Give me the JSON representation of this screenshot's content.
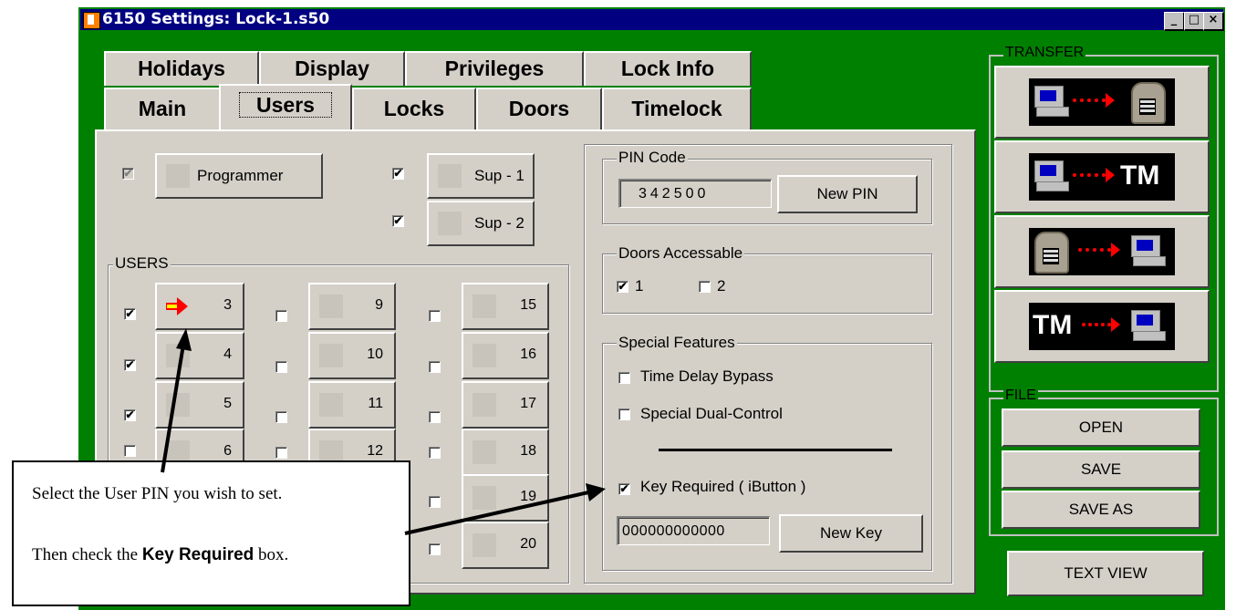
{
  "window": {
    "title": "6150 Settings: Lock-1.s50",
    "buttons": {
      "minimize": "_",
      "restore": "□",
      "close": "×"
    }
  },
  "tabs_row1": [
    "Holidays",
    "Display",
    "Privileges",
    "Lock Info"
  ],
  "tabs_row2": [
    "Main",
    "Users",
    "Locks",
    "Doors",
    "Timelock"
  ],
  "active_tab": "Users",
  "top_buttons": {
    "programmer": {
      "label": "Programmer",
      "checked": true,
      "disabled": true
    },
    "sup1": {
      "label": "Sup - 1",
      "checked": true
    },
    "sup2": {
      "label": "Sup - 2",
      "checked": true
    }
  },
  "users": {
    "group_label": "USERS",
    "col1": [
      {
        "num": "3",
        "checked": true,
        "selected": true
      },
      {
        "num": "4",
        "checked": true
      },
      {
        "num": "5",
        "checked": true
      },
      {
        "num": "6",
        "checked": false
      }
    ],
    "col2": [
      {
        "num": "9",
        "checked": false
      },
      {
        "num": "10",
        "checked": false
      },
      {
        "num": "11",
        "checked": false
      },
      {
        "num": "12",
        "checked": false
      }
    ],
    "col3": [
      {
        "num": "15",
        "checked": false
      },
      {
        "num": "16",
        "checked": false
      },
      {
        "num": "17",
        "checked": false
      },
      {
        "num": "18",
        "checked": false
      },
      {
        "num": "19",
        "checked": false
      },
      {
        "num": "20",
        "checked": false
      }
    ]
  },
  "pin_code": {
    "group_label": "PIN Code",
    "value": "342500",
    "new_pin_label": "New PIN"
  },
  "doors": {
    "group_label": "Doors Accessable",
    "door1": "1",
    "door2": "2",
    "door1_checked": true,
    "door2_checked": false
  },
  "special": {
    "group_label": "Special Features",
    "time_delay": "Time Delay Bypass",
    "dual_control": "Special Dual-Control",
    "key_required": "Key Required ( iButton )",
    "key_value": "000000000000",
    "new_key_label": "New Key"
  },
  "transfer": {
    "group_label": "TRANSFER",
    "tm": "TM"
  },
  "file": {
    "group_label": "FILE",
    "open": "OPEN",
    "save": "SAVE",
    "save_as": "SAVE AS"
  },
  "text_view": "TEXT VIEW",
  "callout": {
    "line1": "Select the User PIN you wish to set.",
    "line2_pre": "Then check the ",
    "line2_bold": "Key Required",
    "line2_post": " box."
  },
  "check_mark": "✔"
}
